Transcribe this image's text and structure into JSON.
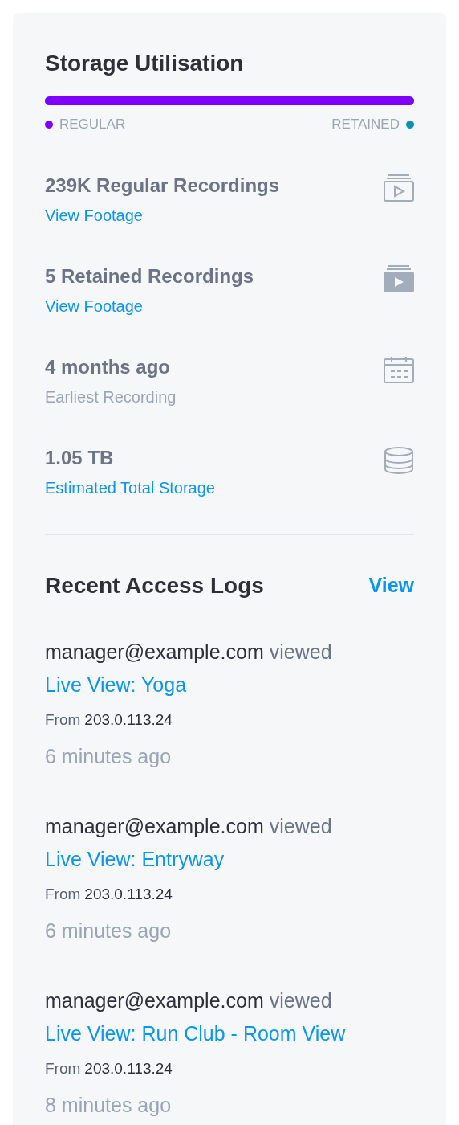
{
  "storage": {
    "title": "Storage Utilisation",
    "bar": {
      "level": 1
    },
    "legend": [
      {
        "label": "REGULAR",
        "color": "#7f00ff"
      },
      {
        "label": "RETAINED",
        "color": "#0891b2"
      }
    ],
    "stats": [
      {
        "kind": "regular",
        "value": "239K Regular Recordings",
        "caption": "View Footage"
      },
      {
        "kind": "retained",
        "value": "5 Retained Recordings",
        "caption": "View Footage"
      },
      {
        "kind": "earliest",
        "value": "4 months ago",
        "caption": "Earliest Recording"
      },
      {
        "kind": "storage",
        "value": "1.05 TB",
        "caption": "Estimated Total Storage"
      }
    ]
  },
  "access_logs": {
    "title": "Recent Access Logs",
    "view_link": "View",
    "entries": [
      {
        "user": "manager@example.com",
        "action": "viewed",
        "target": "Live View: Yoga",
        "from_label": "From",
        "ip": "203.0.113.24",
        "time": "6 minutes ago"
      },
      {
        "user": "manager@example.com",
        "action": "viewed",
        "target": "Live View: Entryway",
        "from_label": "From",
        "ip": "203.0.113.24",
        "time": "6 minutes ago"
      },
      {
        "user": "manager@example.com",
        "action": "viewed",
        "target": "Live View: Run Club - Room View",
        "from_label": "From",
        "ip": "203.0.113.24",
        "time": "8 minutes ago"
      }
    ]
  }
}
